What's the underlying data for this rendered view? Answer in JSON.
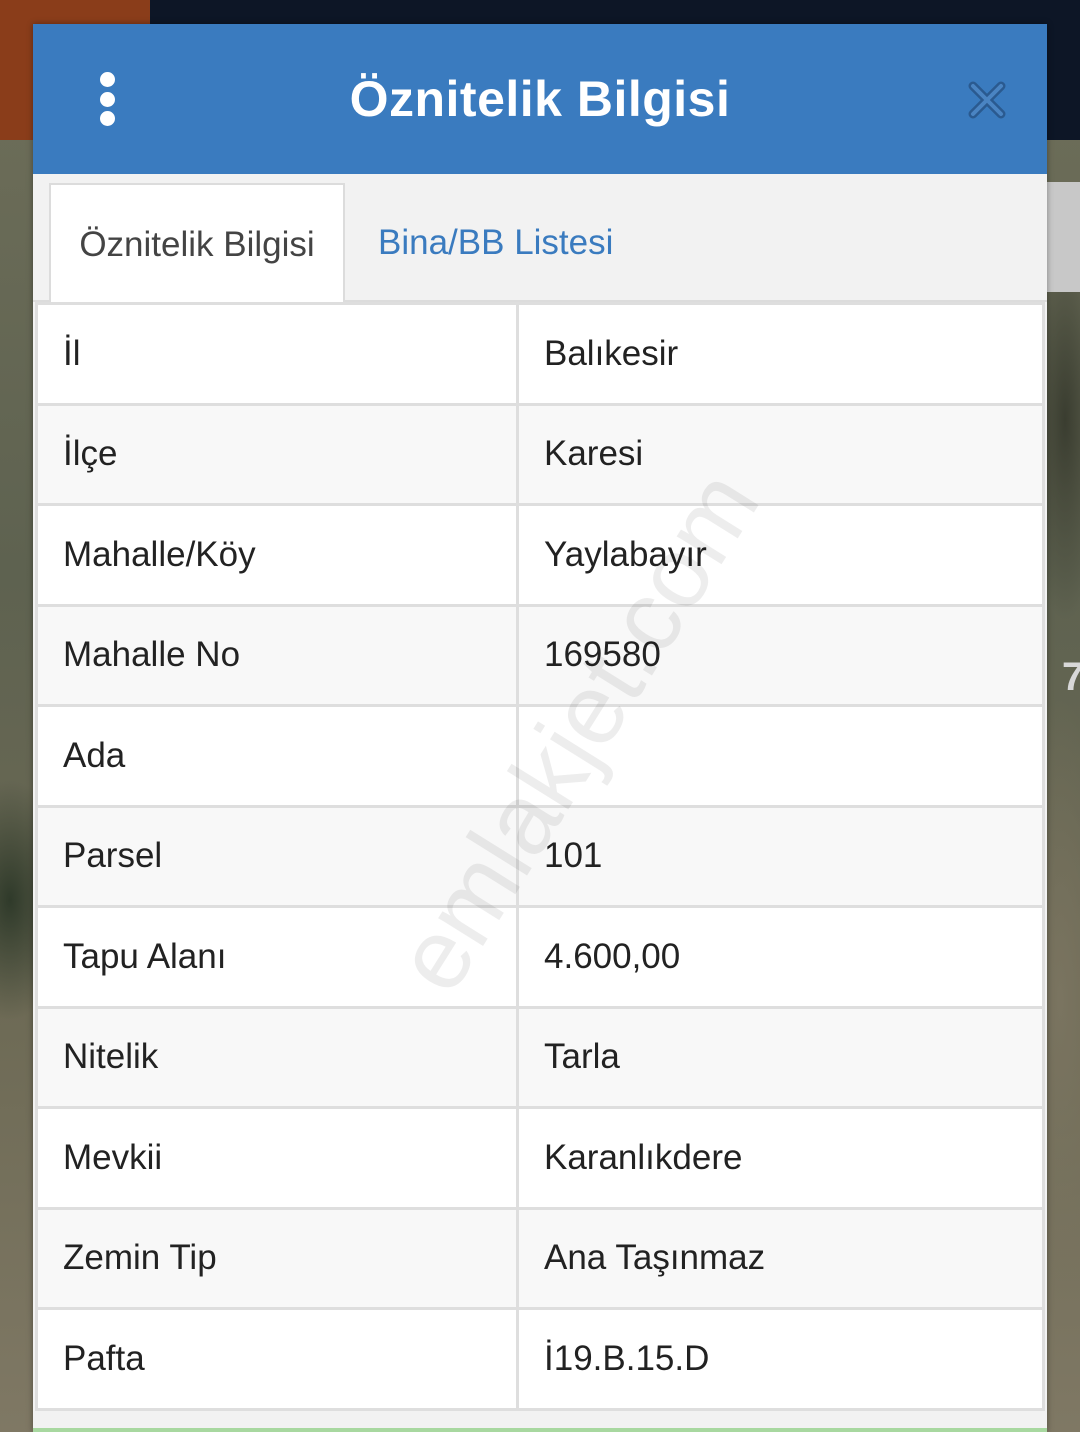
{
  "dialog": {
    "title": "Öznitelik Bilgisi"
  },
  "tabs": [
    {
      "label": "Öznitelik Bilgisi",
      "active": true
    },
    {
      "label": "Bina/BB Listesi",
      "active": false
    }
  ],
  "attributes": [
    {
      "key": "İl",
      "value": "Balıkesir"
    },
    {
      "key": "İlçe",
      "value": "Karesi"
    },
    {
      "key": "Mahalle/Köy",
      "value": "Yaylabayır"
    },
    {
      "key": "Mahalle No",
      "value": "169580"
    },
    {
      "key": "Ada",
      "value": ""
    },
    {
      "key": "Parsel",
      "value": "101"
    },
    {
      "key": "Tapu Alanı",
      "value": "4.600,00"
    },
    {
      "key": "Nitelik",
      "value": "Tarla"
    },
    {
      "key": "Mevkii",
      "value": "Karanlıkdere"
    },
    {
      "key": "Zemin Tip",
      "value": "Ana Taşınmaz"
    },
    {
      "key": "Pafta",
      "value": "İ19.B.15.D"
    }
  ],
  "watermark": "emlakjet.com",
  "colors": {
    "header": "#3a7bbf",
    "tab_link": "#3a7bbf",
    "close_icon": "#2a5a90"
  },
  "icons": {
    "menu": "vertical-dots-icon",
    "close": "close-icon"
  }
}
